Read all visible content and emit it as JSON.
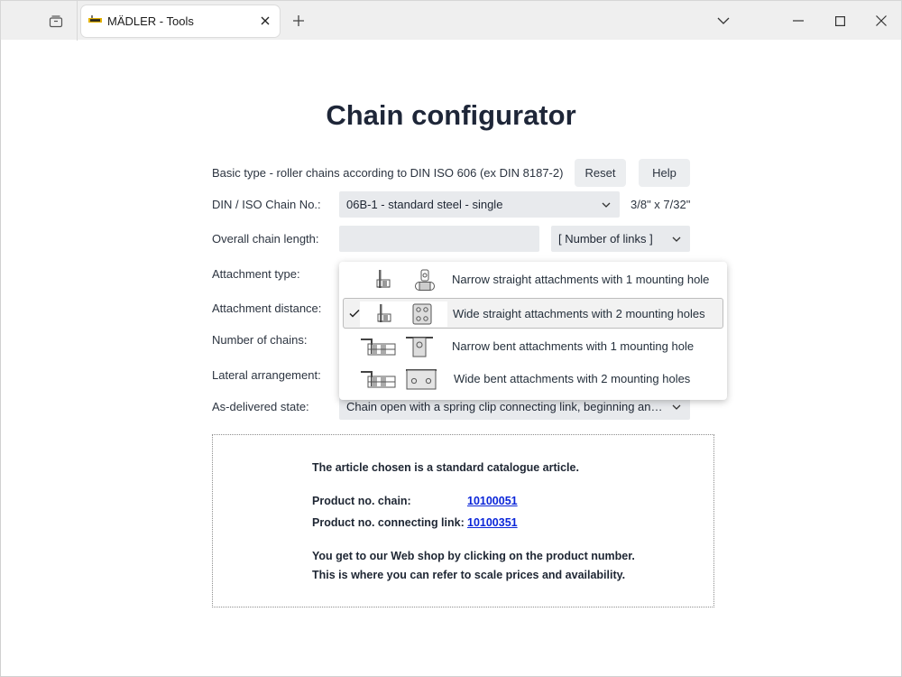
{
  "browser": {
    "tab_title": "MÄDLER - Tools"
  },
  "page": {
    "title": "Chain configurator",
    "basic_type_label": "Basic type - roller chains according to DIN ISO 606 (ex DIN 8187-2)",
    "reset_label": "Reset",
    "help_label": "Help",
    "chain_no_label": "DIN / ISO Chain No.:",
    "chain_no_value": "06B-1 - standard steel - single",
    "chain_dimensions": "3/8\" x 7/32\"",
    "length_label": "Overall chain length:",
    "length_value": "",
    "length_unit_value": "[ Number of links ]",
    "attachment_type_label": "Attachment type:",
    "attachment_distance_label": "Attachment distance:",
    "number_of_chains_label": "Number of chains:",
    "lateral_label": "Lateral arrangement:",
    "delivered_label": "As-delivered state:",
    "delivered_value": "Chain open with a spring clip connecting link, beginning and end with inner links"
  },
  "attachment_dropdown": {
    "options": [
      {
        "label": "Narrow straight attachments with 1 mounting hole",
        "selected": false
      },
      {
        "label": "Wide straight attachments with 2 mounting holes",
        "selected": true
      },
      {
        "label": "Narrow bent attachments with 1 mounting hole",
        "selected": false
      },
      {
        "label": "Wide bent attachments with 2 mounting holes",
        "selected": false
      }
    ]
  },
  "result": {
    "headline": "The article chosen is a standard catalogue article.",
    "chain_label": "Product no. chain:",
    "chain_number": "10100051",
    "link_label": "Product no. connecting link:",
    "link_number": "10100351",
    "info_line1": "You get to our Web shop by clicking on the product number.",
    "info_line2": "This is where you can refer to scale prices and availability."
  },
  "colors": {
    "link": "#0b26d9",
    "field_bg": "#e8eaed",
    "title": "#1e2638"
  }
}
